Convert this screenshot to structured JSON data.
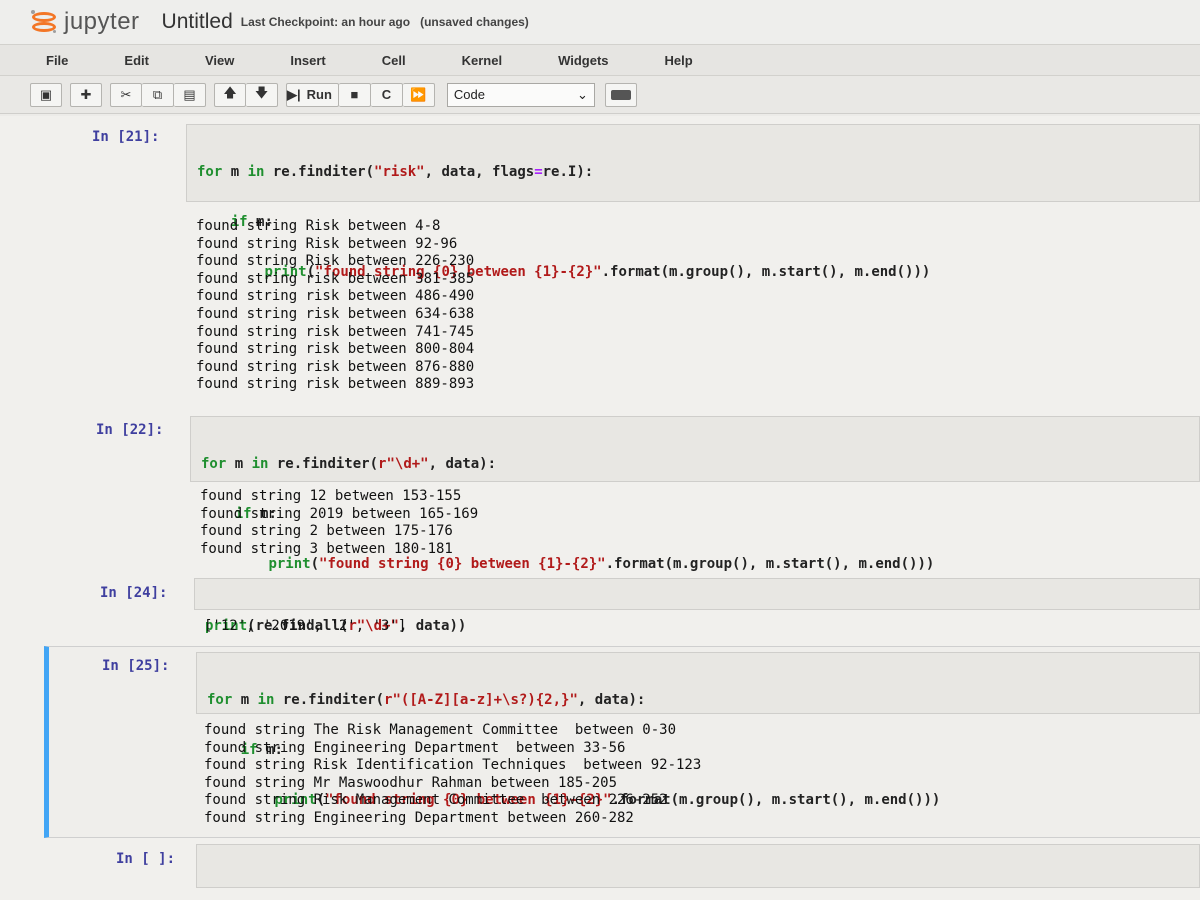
{
  "header": {
    "logo_text": "jupyter",
    "notebook_title": "Untitled",
    "checkpoint": "Last Checkpoint: an hour ago",
    "unsaved": "(unsaved changes)"
  },
  "menu": [
    "File",
    "Edit",
    "View",
    "Insert",
    "Cell",
    "Kernel",
    "Widgets",
    "Help"
  ],
  "toolbar": {
    "run_label": "Run",
    "cell_type": "Code"
  },
  "cells": [
    {
      "prompt": "In [21]:",
      "code": [
        [
          [
            "kw",
            "for "
          ],
          [
            "",
            "m "
          ],
          [
            "kw",
            "in "
          ],
          [
            "",
            "re.finditer("
          ],
          [
            "str",
            "\"risk\""
          ],
          [
            "",
            ", data, flags"
          ],
          [
            "op",
            "="
          ],
          [
            "",
            "re.I):"
          ]
        ],
        [
          [
            "",
            "    "
          ],
          [
            "kw",
            "if "
          ],
          [
            "",
            "m:"
          ]
        ],
        [
          [
            "",
            "        "
          ],
          [
            "fn",
            "print"
          ],
          [
            "",
            "("
          ],
          [
            "str",
            "\"found string {0} between {1}-{2}\""
          ],
          [
            "",
            ".format(m.group(), m.start(), m.end()))"
          ]
        ]
      ],
      "output": [
        "found string Risk between 4-8",
        "found string Risk between 92-96",
        "found string Risk between 226-230",
        "found string risk between 381-385",
        "found string risk between 486-490",
        "found string risk between 634-638",
        "found string risk between 741-745",
        "found string risk between 800-804",
        "found string risk between 876-880",
        "found string risk between 889-893"
      ]
    },
    {
      "prompt": "In [22]:",
      "code": [
        [
          [
            "kw",
            "for "
          ],
          [
            "",
            "m "
          ],
          [
            "kw",
            "in "
          ],
          [
            "",
            "re.finditer("
          ],
          [
            "str",
            "r\"\\d+\""
          ],
          [
            "",
            ", data):"
          ]
        ],
        [
          [
            "",
            "    "
          ],
          [
            "kw",
            "if "
          ],
          [
            "",
            "m:"
          ]
        ],
        [
          [
            "",
            "        "
          ],
          [
            "fn",
            "print"
          ],
          [
            "",
            "("
          ],
          [
            "str",
            "\"found string {0} between {1}-{2}\""
          ],
          [
            "",
            ".format(m.group(), m.start(), m.end()))"
          ]
        ]
      ],
      "output": [
        "found string 12 between 153-155",
        "found string 2019 between 165-169",
        "found string 2 between 175-176",
        "found string 3 between 180-181"
      ]
    },
    {
      "prompt": "In [24]:",
      "code": [
        [
          [
            "fn",
            "print"
          ],
          [
            "",
            "(re.findall("
          ],
          [
            "str",
            "r\"\\d+\""
          ],
          [
            "",
            ", data))"
          ]
        ]
      ],
      "output": [
        "['12', '2019', '2', '3']"
      ]
    },
    {
      "prompt": "In [25]:",
      "code": [
        [
          [
            "kw",
            "for "
          ],
          [
            "",
            "m "
          ],
          [
            "kw",
            "in "
          ],
          [
            "",
            "re.finditer("
          ],
          [
            "str",
            "r\"([A-Z][a-z]+\\s?){2,}\""
          ],
          [
            "",
            ", data):"
          ]
        ],
        [
          [
            "",
            "    "
          ],
          [
            "kw",
            "if "
          ],
          [
            "",
            "m:"
          ]
        ],
        [
          [
            "",
            "        "
          ],
          [
            "fn",
            "print"
          ],
          [
            "",
            "("
          ],
          [
            "str",
            "\"found string {0} between {1}-{2}\""
          ],
          [
            "",
            ".format(m.group(), m.start(), m.end()))"
          ]
        ]
      ],
      "output": [
        "found string The Risk Management Committee  between 0-30",
        "found string Engineering Department  between 33-56",
        "found string Risk Identification Techniques  between 92-123",
        "found string Mr Maswoodhur Rahman between 185-205",
        "found string Risk Management Committee  between 226-252",
        "found string Engineering Department between 260-282"
      ]
    },
    {
      "prompt": "In [ ]:",
      "code": [
        [
          [
            "",
            ""
          ]
        ]
      ],
      "output": []
    }
  ]
}
